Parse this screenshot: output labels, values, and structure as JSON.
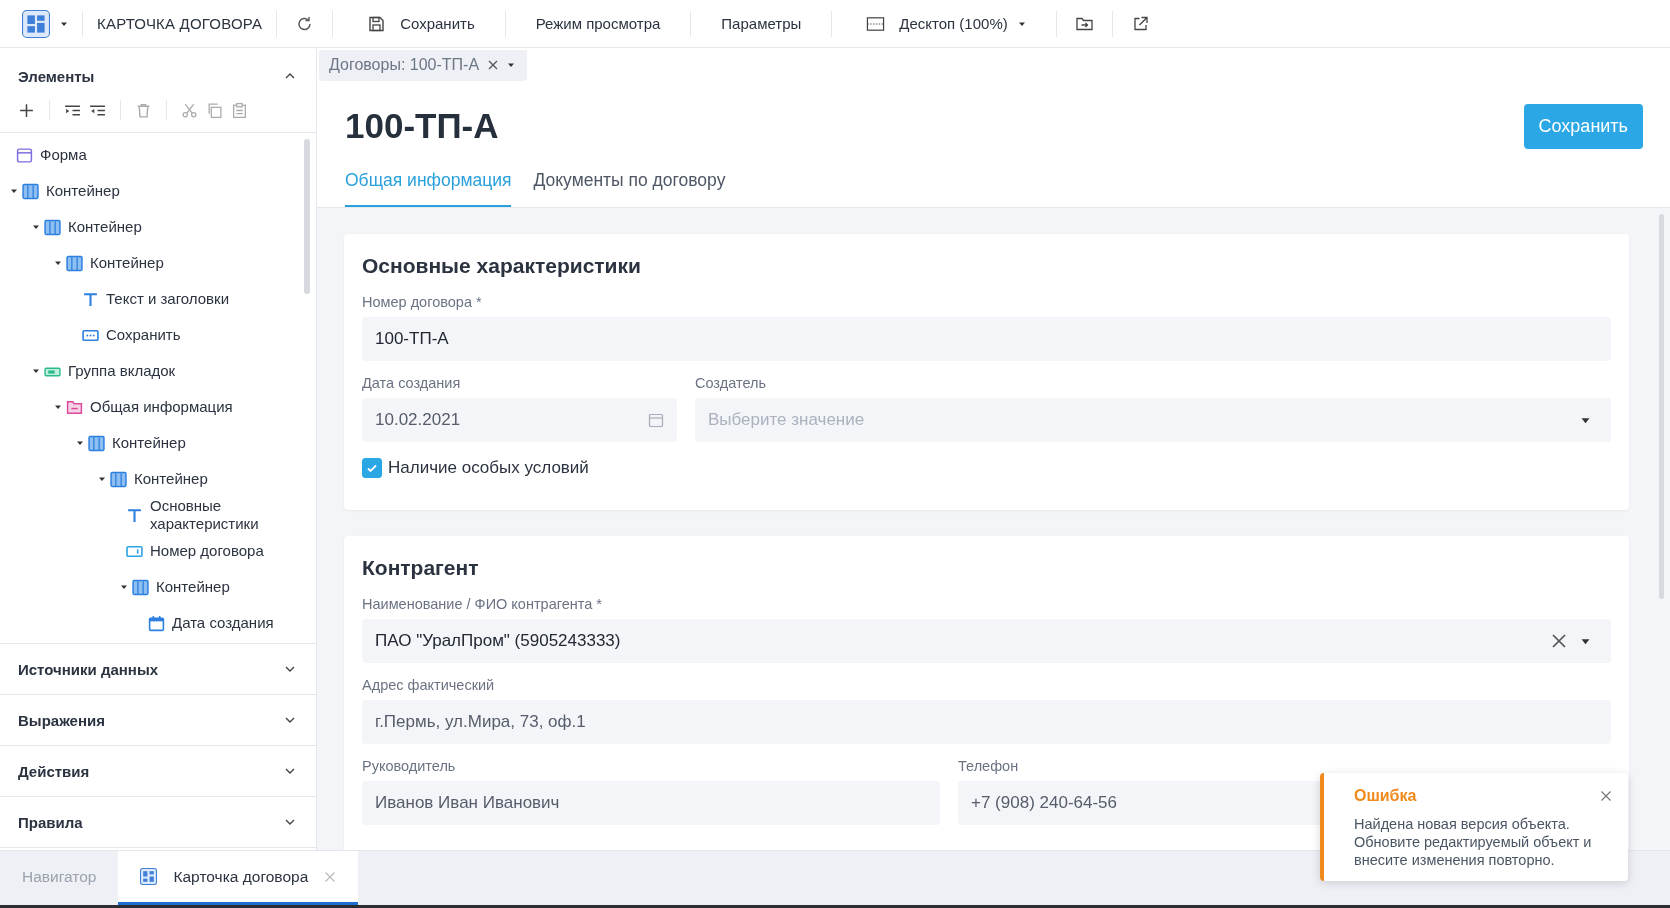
{
  "toolbar": {
    "title": "КАРТОЧКА ДОГОВОРА",
    "save": "Сохранить",
    "view_mode": "Режим просмотра",
    "params": "Параметры",
    "device": "Десктоп (100%)"
  },
  "sidebar": {
    "title": "Элементы",
    "expanded": true,
    "tree": [
      {
        "label": "Форма",
        "kind": "form"
      },
      {
        "label": "Контейнер",
        "kind": "container",
        "expanded": true,
        "children": [
          {
            "label": "Контейнер",
            "kind": "container",
            "expanded": true,
            "children": [
              {
                "label": "Контейнер",
                "kind": "container",
                "expanded": true,
                "children": [
                  {
                    "label": "Текст и заголовки",
                    "kind": "text"
                  },
                  {
                    "label": "Сохранить",
                    "kind": "button"
                  }
                ]
              }
            ]
          },
          {
            "label": "Группа вкладок",
            "kind": "tabs",
            "expanded": true,
            "children": [
              {
                "label": "Общая информация",
                "kind": "tab",
                "expanded": true,
                "children": [
                  {
                    "label": "Контейнер",
                    "kind": "container",
                    "expanded": true,
                    "children": [
                      {
                        "label": "Контейнер",
                        "kind": "container",
                        "expanded": true,
                        "children": [
                          {
                            "label": "Основные характеристики",
                            "kind": "text"
                          },
                          {
                            "label": "Номер договора",
                            "kind": "input"
                          },
                          {
                            "label": "Контейнер",
                            "kind": "container",
                            "expanded": true,
                            "children": [
                              {
                                "label": "Дата создания",
                                "kind": "date"
                              }
                            ]
                          }
                        ]
                      }
                    ]
                  }
                ]
              }
            ]
          }
        ]
      }
    ],
    "panels": [
      {
        "title": "Источники данных",
        "expanded": false
      },
      {
        "title": "Выражения",
        "expanded": false
      },
      {
        "title": "Действия",
        "expanded": false
      },
      {
        "title": "Правила",
        "expanded": false
      }
    ]
  },
  "doc_tab": {
    "label": "Договоры: 100-ТП-А"
  },
  "page": {
    "title": "100-ТП-А",
    "save_button": "Сохранить",
    "tabs": [
      {
        "label": "Общая информация",
        "selected": true
      },
      {
        "label": "Документы по договору",
        "selected": false
      }
    ],
    "sections": [
      {
        "title": "Основные характеристики",
        "rows": [
          [
            {
              "kind": "text",
              "label": "Номер договора *",
              "value": "100-ТП-А",
              "disabled": false
            }
          ],
          [
            {
              "kind": "date",
              "label": "Дата создания",
              "value": "10.02.2021",
              "disabled": true
            },
            {
              "kind": "select",
              "label": "Создатель",
              "placeholder": "Выберите значение"
            }
          ],
          [
            {
              "kind": "checkbox",
              "label": "Наличие особых условий",
              "checked": true
            }
          ]
        ]
      },
      {
        "title": "Контрагент",
        "rows": [
          [
            {
              "kind": "lookup",
              "label": "Наименование / ФИО контрагента *",
              "value": "ПАО \"УралПром\" (5905243333)",
              "disabled": false
            }
          ],
          [
            {
              "kind": "text",
              "label": "Адрес фактический",
              "value": "г.Пермь, ул.Мира, 73, оф.1",
              "disabled": true
            }
          ],
          [
            {
              "kind": "text",
              "label": "Руководитель",
              "value": "Иванов Иван Иванович",
              "disabled": true
            },
            {
              "kind": "text",
              "label": "Телефон",
              "value": "+7 (908) 240-64-56",
              "disabled": true
            }
          ]
        ]
      }
    ]
  },
  "toast": {
    "title": "Ошибка",
    "message": "Найдена новая версия объекта. Обновите редактируемый объект и внесите изменения повторно."
  },
  "bottom_tabs": [
    {
      "label": "Навигатор",
      "selected": false
    },
    {
      "label": "Карточка договора",
      "selected": true
    }
  ]
}
